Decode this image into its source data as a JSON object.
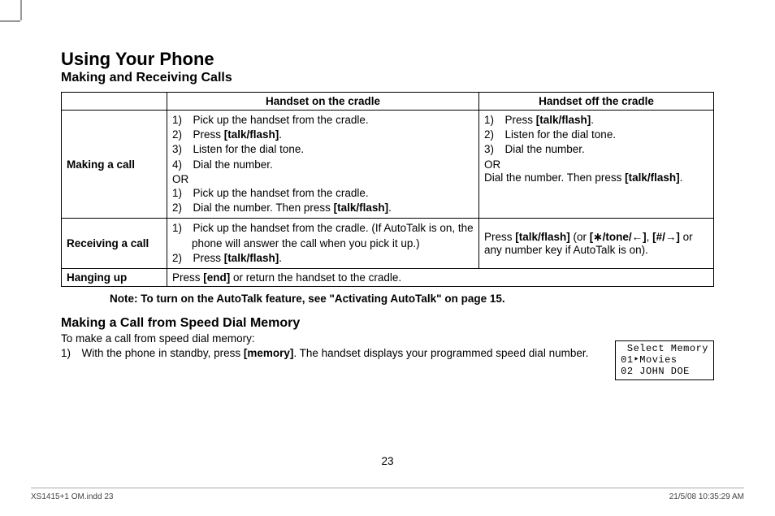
{
  "title": "Using Your Phone",
  "subtitle": "Making and Receiving Calls",
  "table": {
    "headers": {
      "col1": "Handset on the cradle",
      "col2": "Handset off the cradle"
    },
    "rows": {
      "making": {
        "label": "Making a call",
        "on_cradle": {
          "list1": {
            "i1": "1) Pick up the handset from the cradle.",
            "i2": "2) Press ",
            "i2b": "[talk/flash]",
            "i2c": ".",
            "i3": "3) Listen for the dial tone.",
            "i4": "4) Dial the number."
          },
          "or": "OR",
          "list2": {
            "i1": "1) Pick up the handset from the cradle.",
            "i2": "2) Dial the number. Then press ",
            "i2b": "[talk/flash]",
            "i2c": "."
          }
        },
        "off_cradle": {
          "list1": {
            "i1": "1) Press ",
            "i1b": "[talk/flash]",
            "i1c": ".",
            "i2": "2) Listen for the dial tone.",
            "i3": "3) Dial the number."
          },
          "or": "OR",
          "line2a": "Dial the number. Then press ",
          "line2b": "[talk/flash]",
          "line2c": "."
        }
      },
      "receiving": {
        "label": "Receiving a call",
        "on_cradle": {
          "i1": "1) Pick up the handset from the cradle. (If AutoTalk is on, the phone will answer the call when you pick it up.)",
          "i2": "2) Press ",
          "i2b": "[talk/flash]",
          "i2c": "."
        },
        "off_cradle": {
          "t1": "Press ",
          "t1b": "[talk/flash]",
          "t2": " (or ",
          "t2b": "[∗/tone/←]",
          "t3": ", ",
          "t3b": "[#/→]",
          "t4": " or any number key if AutoTalk is on)."
        }
      },
      "hanging": {
        "label": "Hanging up",
        "content_a": "Press ",
        "content_b": "[end]",
        "content_c": " or return the handset to the cradle."
      }
    }
  },
  "note": "Note: To turn on the AutoTalk feature, see \"Activating AutoTalk\" on page 15.",
  "speed_dial": {
    "heading": "Making a Call from Speed Dial Memory",
    "intro": "To make a call from speed dial memory:",
    "step1a": "1) With the phone in standby, press ",
    "step1b": "[memory]",
    "step1c": ". The handset displays your programmed speed dial number.",
    "screen": " Select Memory\n01‣Movies\n02 JOHN DOE"
  },
  "page_number": "23",
  "footer": {
    "left": "XS1415+1 OM.indd   23",
    "right": "21/5/08   10:35:29 AM"
  }
}
